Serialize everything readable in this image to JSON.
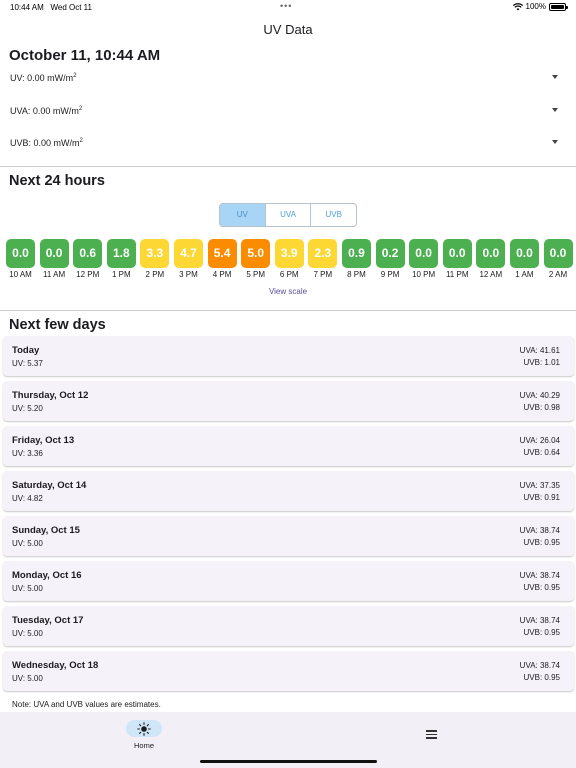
{
  "status": {
    "time": "10:44 AM",
    "date": "Wed Oct 11",
    "dots": "•••",
    "battery": "100%"
  },
  "app": {
    "title": "UV Data"
  },
  "current": {
    "heading": "October 11, 10:44 AM",
    "uv": "UV: 0.00 mW/m",
    "uva": "UVA: 0.00 mW/m",
    "uvb": "UVB: 0.00 mW/m",
    "unit_exp": "2"
  },
  "forecast": {
    "heading": "Next 24 hours",
    "tabs": [
      "UV",
      "UVA",
      "UVB"
    ],
    "active_tab": "UV",
    "view_scale": "View scale",
    "colors": {
      "low": "#4caf50",
      "moderate": "#fdd835",
      "high": "#fb8c00"
    },
    "hours": [
      {
        "time": "10 AM",
        "value": "0.0",
        "level": "low"
      },
      {
        "time": "11 AM",
        "value": "0.0",
        "level": "low"
      },
      {
        "time": "12 PM",
        "value": "0.6",
        "level": "low"
      },
      {
        "time": "1 PM",
        "value": "1.8",
        "level": "low"
      },
      {
        "time": "2 PM",
        "value": "3.3",
        "level": "moderate"
      },
      {
        "time": "3 PM",
        "value": "4.7",
        "level": "moderate"
      },
      {
        "time": "4 PM",
        "value": "5.4",
        "level": "high"
      },
      {
        "time": "5 PM",
        "value": "5.0",
        "level": "high"
      },
      {
        "time": "6 PM",
        "value": "3.9",
        "level": "moderate"
      },
      {
        "time": "7 PM",
        "value": "2.3",
        "level": "moderate"
      },
      {
        "time": "8 PM",
        "value": "0.9",
        "level": "low"
      },
      {
        "time": "9 PM",
        "value": "0.2",
        "level": "low"
      },
      {
        "time": "10 PM",
        "value": "0.0",
        "level": "low"
      },
      {
        "time": "11 PM",
        "value": "0.0",
        "level": "low"
      },
      {
        "time": "12 AM",
        "value": "0.0",
        "level": "low"
      },
      {
        "time": "1 AM",
        "value": "0.0",
        "level": "low"
      },
      {
        "time": "2 AM",
        "value": "0.0",
        "level": "low"
      }
    ]
  },
  "days": {
    "heading": "Next few days",
    "items": [
      {
        "name": "Today",
        "uv": "UV:  5.37",
        "uva": "UVA: 41.61",
        "uvb": "UVB: 1.01"
      },
      {
        "name": "Thursday, Oct 12",
        "uv": "UV:  5.20",
        "uva": "UVA: 40.29",
        "uvb": "UVB: 0.98"
      },
      {
        "name": "Friday, Oct 13",
        "uv": "UV:  3.36",
        "uva": "UVA: 26.04",
        "uvb": "UVB: 0.64"
      },
      {
        "name": "Saturday, Oct 14",
        "uv": "UV:  4.82",
        "uva": "UVA: 37.35",
        "uvb": "UVB: 0.91"
      },
      {
        "name": "Sunday, Oct 15",
        "uv": "UV:  5.00",
        "uva": "UVA: 38.74",
        "uvb": "UVB: 0.95"
      },
      {
        "name": "Monday, Oct 16",
        "uv": "UV:  5.00",
        "uva": "UVA: 38.74",
        "uvb": "UVB: 0.95"
      },
      {
        "name": "Tuesday, Oct 17",
        "uv": "UV:  5.00",
        "uva": "UVA: 38.74",
        "uvb": "UVB: 0.95"
      },
      {
        "name": "Wednesday, Oct 18",
        "uv": "UV:  5.00",
        "uva": "UVA: 38.74",
        "uvb": "UVB: 0.95"
      }
    ],
    "note": "Note: UVA and UVB values are estimates."
  },
  "nav": {
    "home_label": "Home",
    "home_icon": "sun-icon",
    "menu_icon": "menu-icon"
  }
}
